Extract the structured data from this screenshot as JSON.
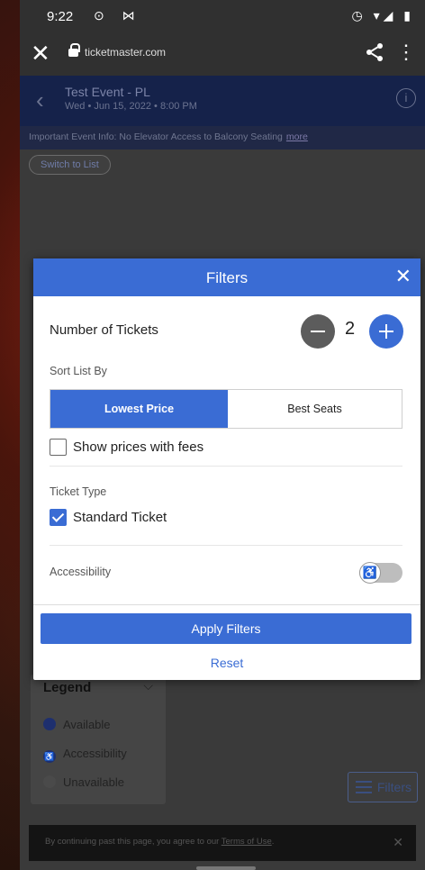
{
  "status_bar": {
    "time": "9:22",
    "left_icons": "⊙ ⋈",
    "right_icons": "◷ ▾◢ ▮"
  },
  "browser": {
    "url": "ticketmaster.com"
  },
  "event": {
    "title": "Test Event - PL",
    "date": "Wed • Jun 15, 2022 • 8:00 PM",
    "important_prefix": "Important Event Info:",
    "important_text": " No Elevator Access to Balcony Seating",
    "more_link": "more",
    "switch_to_list": "Switch to List"
  },
  "filters_modal": {
    "title": "Filters",
    "number_of_tickets_label": "Number of Tickets",
    "ticket_count": "2",
    "sort_label": "Sort List By",
    "sort_options": [
      "Lowest Price",
      "Best Seats"
    ],
    "sort_selected": "Lowest Price",
    "show_fees_label": "Show prices with fees",
    "show_fees_checked": false,
    "ticket_type_label": "Ticket Type",
    "standard_ticket_label": "Standard Ticket",
    "standard_ticket_checked": true,
    "accessibility_label": "Accessibility",
    "accessibility_enabled": false,
    "apply_button": "Apply Filters",
    "reset_link": "Reset"
  },
  "legend": {
    "title": "Legend",
    "items": [
      {
        "label": "Available",
        "color": "#1e2f6e"
      },
      {
        "label": "Accessibility",
        "color": "#1e2f6e"
      },
      {
        "label": "Unavailable",
        "color": "#4a4a4a"
      }
    ]
  },
  "filters_button": "Filters",
  "cookie": {
    "text": "By continuing past this page, you agree to our ",
    "terms_link": "Terms of Use",
    "suffix": "."
  },
  "colors": {
    "brand_blue": "#3a6cd4",
    "header_navy": "#15224a"
  }
}
